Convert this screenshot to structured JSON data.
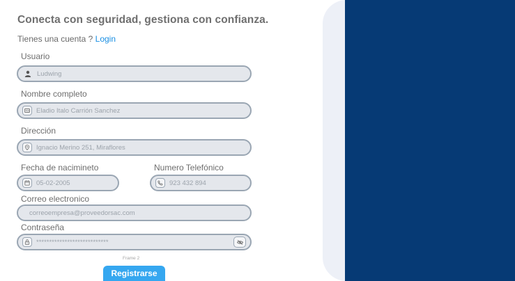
{
  "form": {
    "title": "Conecta con seguridad, gestiona con confianza.",
    "account_prompt": "Tienes una cuenta ?",
    "login_link": "Login",
    "usuario": {
      "label": "Usuario",
      "value": "Ludwing",
      "icon": "user-icon"
    },
    "nombre": {
      "label": "Nombre completo",
      "value": "Eladio Italo Carrión Sanchez",
      "icon": "id-card-icon"
    },
    "direccion": {
      "label": "Dirección",
      "value": "Ignacio Merino 251, Miraflores",
      "icon": "location-icon"
    },
    "fecha": {
      "label": "Fecha de nacimineto",
      "value": "05-02-2005",
      "icon": "calendar-icon"
    },
    "telefono": {
      "label": "Numero Telefónico",
      "value": "923 432 894",
      "icon": "phone-icon"
    },
    "correo": {
      "label": "Correo electronico",
      "value": "correoempresa@proveedorsac.com"
    },
    "contrasena": {
      "label": "Contraseña",
      "value": "****************************",
      "icon": "lock-icon",
      "toggle_icon": "eye-icon"
    },
    "frame_label": "Frame 2",
    "submit_label": "Registrarse"
  },
  "colors": {
    "accent": "#35a7f0",
    "link": "#1a8fe3",
    "panel_dark": "#063a75",
    "panel_light": "#edf0f7",
    "field_bg": "#e4e7ec",
    "field_border": "#9aa6b3"
  }
}
